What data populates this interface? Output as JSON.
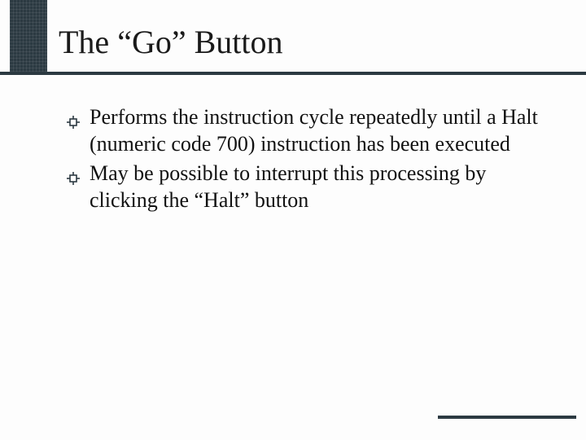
{
  "slide": {
    "title": "The “Go” Button",
    "bullets": [
      "Performs the instruction cycle repeatedly until a Halt (numeric code 700) instruction has been executed",
      "May be possible to interrupt this processing by clicking the “Halt” button"
    ]
  },
  "theme": {
    "accent": "#2c3a42"
  }
}
